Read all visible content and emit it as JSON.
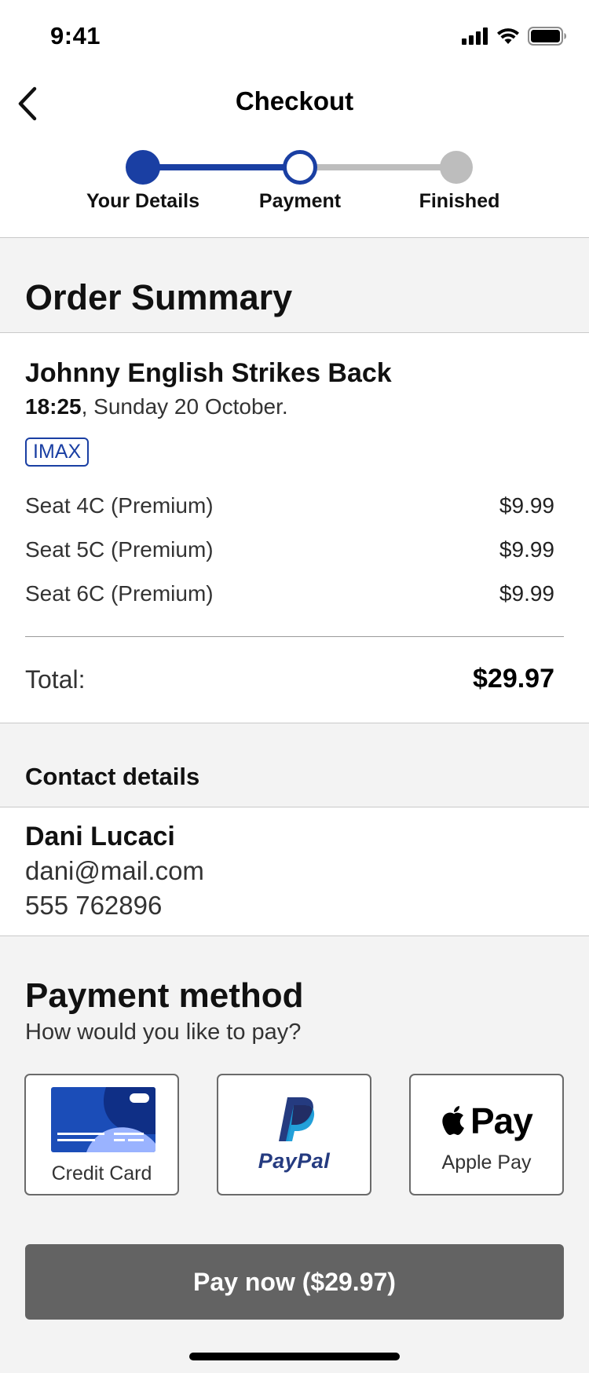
{
  "status_bar": {
    "time": "9:41"
  },
  "header": {
    "title": "Checkout"
  },
  "stepper": {
    "steps": [
      "Your Details",
      "Payment",
      "Finished"
    ],
    "current_step": 2
  },
  "order_summary": {
    "title": "Order Summary",
    "movie": "Johnny English Strikes Back",
    "time": "18:25",
    "date": ", Sunday 20 October.",
    "format_badge": "IMAX",
    "items": [
      {
        "label": "Seat 4C (Premium)",
        "price": "$9.99"
      },
      {
        "label": "Seat 5C (Premium)",
        "price": "$9.99"
      },
      {
        "label": "Seat 6C (Premium)",
        "price": "$9.99"
      }
    ],
    "total_label": "Total:",
    "total_value": "$29.97"
  },
  "contact": {
    "title": "Contact details",
    "name": "Dani Lucaci",
    "email": "dani@mail.com",
    "phone": "555 762896"
  },
  "payment": {
    "title": "Payment method",
    "subtitle": "How would you like to pay?",
    "methods": [
      {
        "label": "Credit Card",
        "icon": "credit-card-icon"
      },
      {
        "label": "PayPal",
        "icon": "paypal-logo"
      },
      {
        "label": "Apple Pay",
        "icon": "apple-pay-logo",
        "logo_text": "Pay"
      }
    ],
    "pay_button": "Pay now ($29.97)"
  },
  "colors": {
    "accent": "#1a3fa3",
    "inactive": "#bdbdbd",
    "button": "#636363",
    "section_bg": "#f3f3f3"
  }
}
